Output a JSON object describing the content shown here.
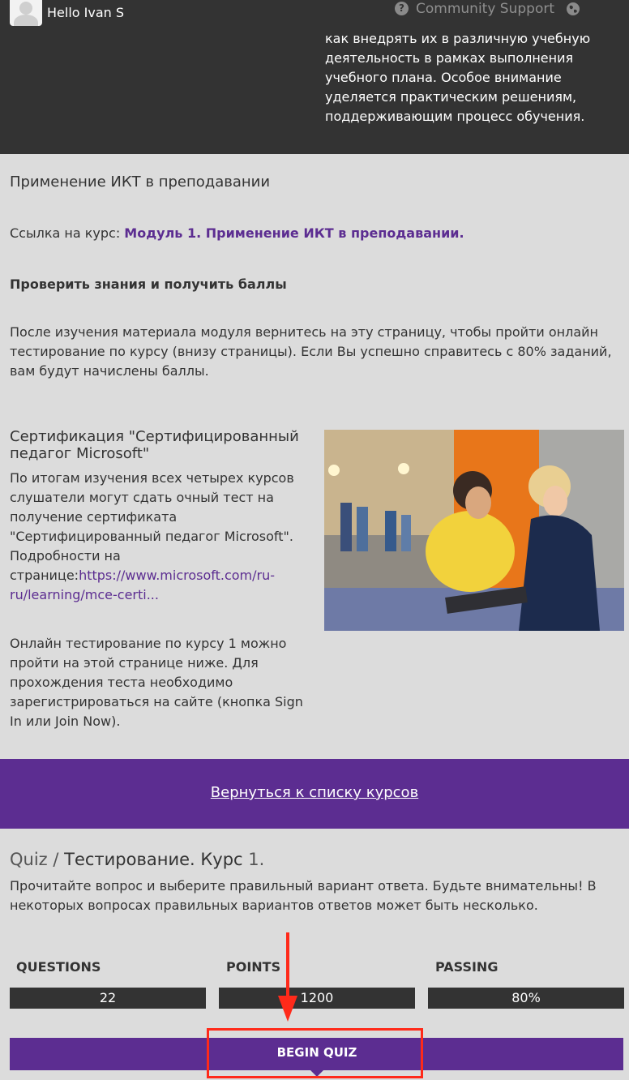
{
  "header": {
    "greeting": "Hello Ivan S",
    "community_support": "Community Support",
    "description": "как внедрять их в различную учебную деятельность в рамках выполнения учебного плана. Особое внимание уделяется практическим решениям, поддерживающим процесс обучения."
  },
  "content": {
    "title": "Применение ИКТ в преподавании",
    "course_link_prefix": "Ссылка на курс: ",
    "course_link_text": "Модуль 1. Применение ИКТ в преподавании.",
    "check_title": "Проверить знания и получить баллы",
    "after_text": "После изучения материала модуля вернитесь на эту страницу, чтобы пройти онлайн тестирование по курсу (внизу страницы). Если Вы успешно справитесь с 80% заданий, вам будут начислены баллы.",
    "cert_title": "Сертификация \"Сертифицированный педагог Microsoft\"",
    "cert_text": "По итогам изучения всех четырех курсов слушатели могут сдать очный тест на получение сертификата \"Сертифицированный педагог Microsoft\". Подробности на странице:",
    "cert_url": "https://www.microsoft.com/ru-ru/learning/mce-certi...",
    "online_text": "Онлайн тестирование по курсу 1 можно пройти на этой странице ниже. Для прохождения теста необходимо зарегистрироваться на сайте (кнопка Sign In или Join Now)."
  },
  "band": {
    "back_link": "Вернуться к списку курсов"
  },
  "quiz": {
    "title_prefix": "Quiz / ",
    "title_main": "Тестирование. Курс ",
    "title_num": "1.",
    "description": "Прочитайте вопрос и выберите правильный вариант ответа. Будьте внимательны! В некоторых вопросах правильных вариантов ответов может быть несколько.",
    "stats": [
      {
        "label": "QUESTIONS",
        "value": "22"
      },
      {
        "label": "POINTS",
        "value": "1200"
      },
      {
        "label": "PASSING",
        "value": "80%"
      }
    ],
    "begin_label": "BEGIN QUIZ"
  },
  "colors": {
    "header_bg": "#333333",
    "page_bg": "#dcdcdc",
    "accent_purple": "#5c2d91",
    "highlight_red": "#ff2a1a"
  }
}
